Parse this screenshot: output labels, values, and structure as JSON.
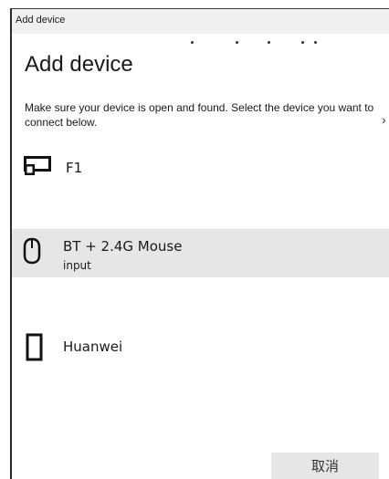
{
  "window": {
    "title": "Add device"
  },
  "page": {
    "heading": "Add device",
    "instructions": "Make sure your device is open and found. Select the device you want to connect below.",
    "chevron": "›"
  },
  "devices": [
    {
      "name": "F1",
      "subtitle": "",
      "icon": "display-icon",
      "selected": false
    },
    {
      "name": "BT + 2.4G  Mouse",
      "subtitle": "input",
      "icon": "mouse-icon",
      "selected": true
    },
    {
      "name": "Huanwei",
      "subtitle": "",
      "icon": "phone-icon",
      "selected": false
    }
  ],
  "footer": {
    "cancel_label": "取消"
  },
  "colors": {
    "selected_row": "#e6e6e6",
    "button_bg": "#e6e6e6",
    "titlebar_bg": "#f0f0f0"
  }
}
